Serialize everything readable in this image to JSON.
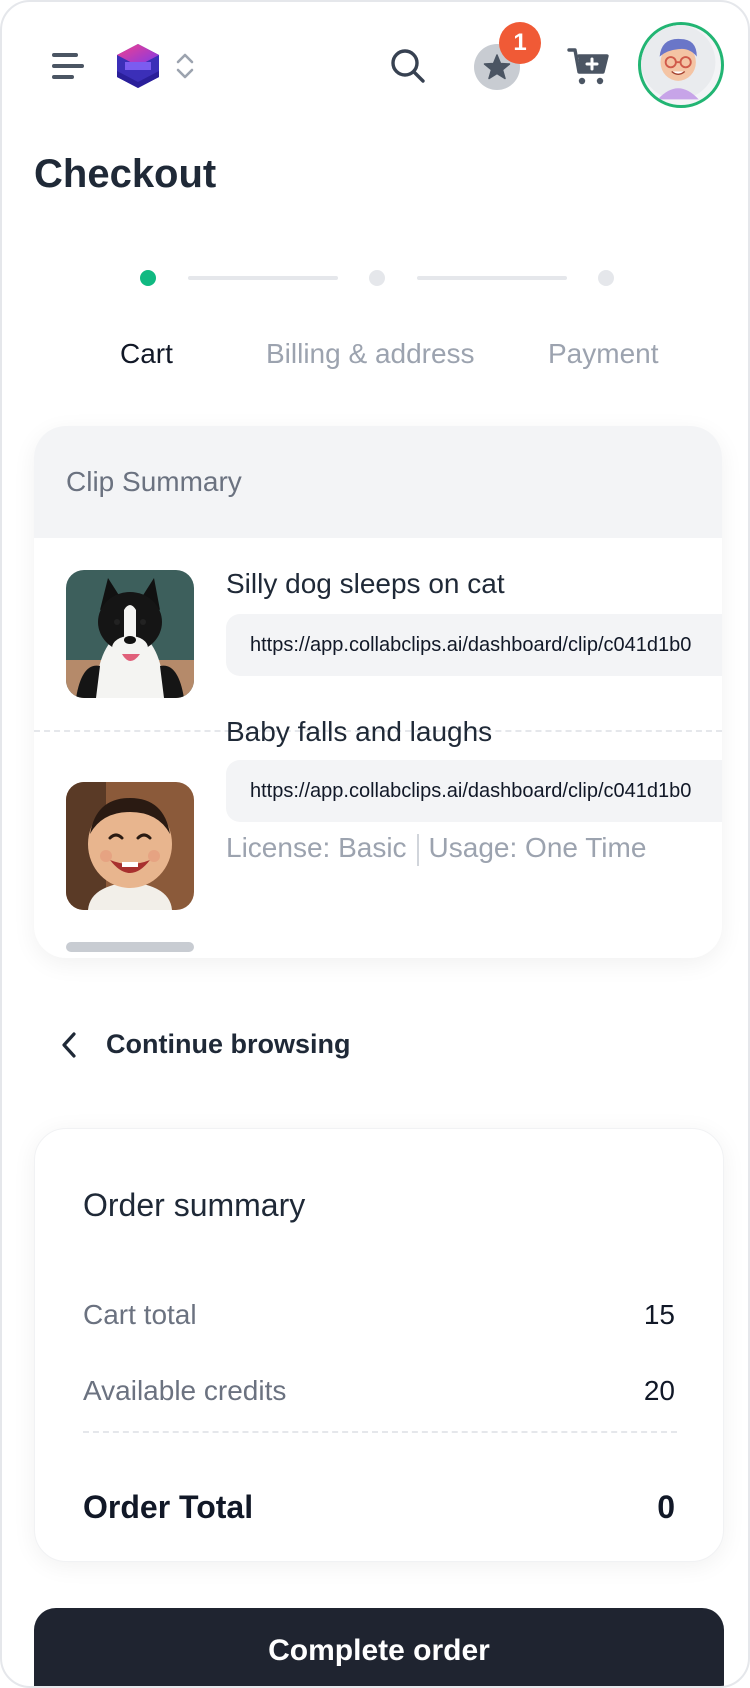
{
  "header": {
    "notification_count": "1",
    "icons": {
      "menu": "menu-icon",
      "logo": "brand-logo",
      "switch": "chevron-up-down-icon",
      "search": "search-icon",
      "favorites": "star-icon",
      "cart": "cart-plus-icon",
      "avatar": "user-avatar"
    }
  },
  "page_title": "Checkout",
  "stepper": {
    "active_index": 0,
    "steps": [
      {
        "label": "Cart"
      },
      {
        "label": "Billing & address"
      },
      {
        "label": "Payment"
      }
    ]
  },
  "clip_summary": {
    "title": "Clip Summary",
    "items": [
      {
        "title": "Silly dog sleeps on cat",
        "url": "https://app.collabclips.ai/dashboard/clip/c041d1b0",
        "thumbnail": "dog-thumbnail"
      },
      {
        "title": "Baby falls and laughs",
        "url": "https://app.collabclips.ai/dashboard/clip/c041d1b0",
        "license": "License: Basic",
        "usage": "Usage: One Time",
        "thumbnail": "baby-thumbnail"
      }
    ]
  },
  "continue_browsing": "Continue browsing",
  "order_summary": {
    "title": "Order summary",
    "rows": [
      {
        "label": "Cart total",
        "value": "15"
      },
      {
        "label": "Available credits",
        "value": "20"
      }
    ],
    "total_label": "Order Total",
    "total_value": "0"
  },
  "complete_button": "Complete order",
  "colors": {
    "accent_green": "#10b981",
    "badge_red": "#f05a36",
    "primary_dark": "#1f2430"
  }
}
